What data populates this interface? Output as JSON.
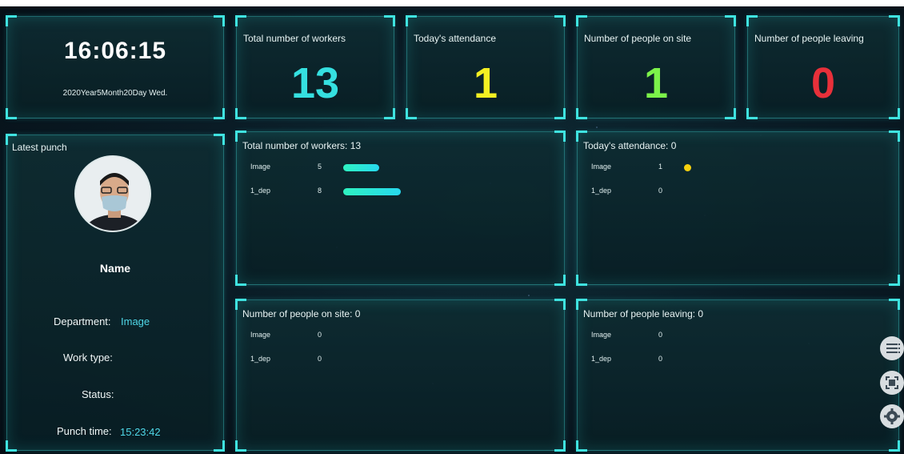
{
  "clock": {
    "time": "16:06:15",
    "date": "2020Year5Month20Day  Wed."
  },
  "stats": [
    {
      "title": "Total number of workers",
      "value": "13",
      "color": "#35e0e0"
    },
    {
      "title": "Today's attendance",
      "value": "1",
      "color": "#f4f022"
    },
    {
      "title": "Number of people on site",
      "value": "1",
      "color": "#7cf24a"
    },
    {
      "title": "Number of people leaving",
      "value": "0",
      "color": "#e8303a"
    }
  ],
  "latest_punch": {
    "title": "Latest punch",
    "name": "Name",
    "department_label": "Department:",
    "department_value": "Image",
    "work_type_label": "Work type:",
    "status_label": "Status:",
    "punch_time_label": "Punch time:",
    "punch_time_value": "15:23:42"
  },
  "panels": {
    "workers": {
      "title": "Total number of workers: 13",
      "rows": [
        {
          "name": "Image",
          "count": "5",
          "bar_fraction": 0.625
        },
        {
          "name": "1_dep",
          "count": "8",
          "bar_fraction": 1.0
        }
      ]
    },
    "attendance": {
      "title": "Today's attendance: 0",
      "rows": [
        {
          "name": "Image",
          "count": "1"
        },
        {
          "name": "1_dep",
          "count": "0"
        }
      ]
    },
    "onsite": {
      "title": "Number of people on site: 0",
      "rows": [
        {
          "name": "Image",
          "count": "0"
        },
        {
          "name": "1_dep",
          "count": "0"
        }
      ]
    },
    "leaving": {
      "title": "Number of people leaving: 0",
      "rows": [
        {
          "name": "Image",
          "count": "0"
        },
        {
          "name": "1_dep",
          "count": "0"
        }
      ]
    }
  },
  "toolbar": {
    "icons": [
      "menu-icon",
      "fullscreen-icon",
      "gear-icon"
    ]
  }
}
